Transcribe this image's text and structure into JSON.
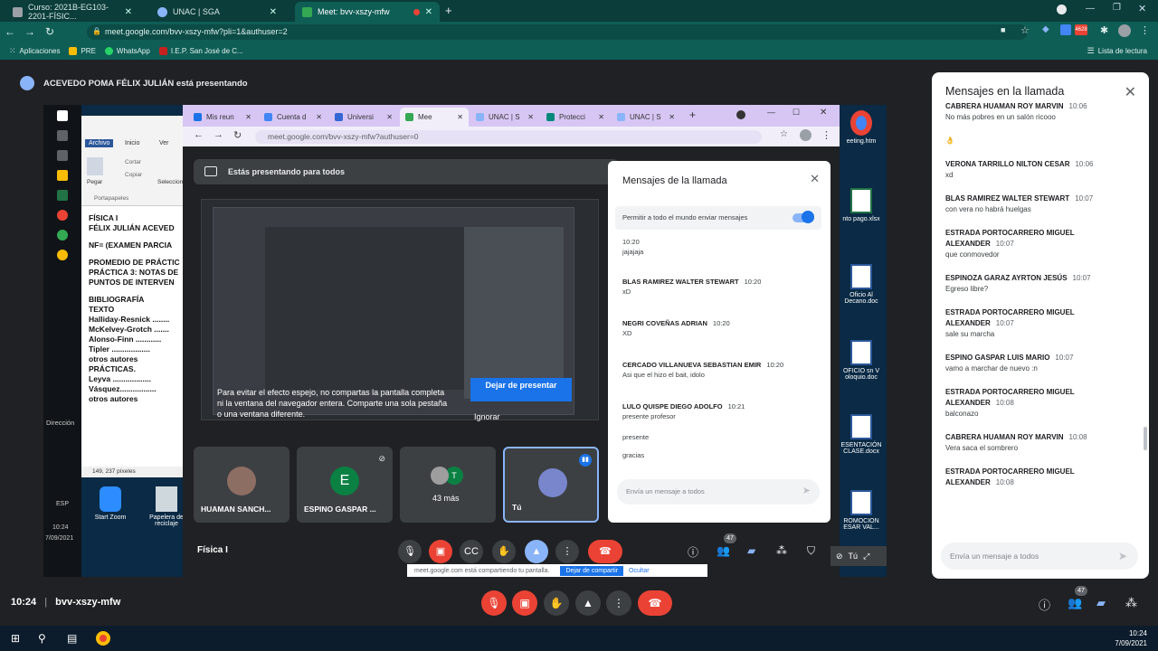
{
  "browser": {
    "tabs": [
      {
        "label": "Curso: 2021B-EG103-2201-FÍSIC...",
        "color": "#9aa0a6"
      },
      {
        "label": "UNAC | SGA",
        "color": "#8ab4f8"
      },
      {
        "label": "Meet: bvv-xszy-mfw",
        "color": "#34a853",
        "active": true
      }
    ],
    "new_tab": "+",
    "url": "meet.google.com/bvv-xszy-mfw?pli=1&authuser=2",
    "bookmarks": [
      "Aplicaciones",
      "PRE",
      "WhatsApp",
      "I.E.P. San José de C..."
    ],
    "reading_list": "Lista de lectura",
    "badge": "4628"
  },
  "presenting": {
    "banner": "ACEVEDO POMA FÉLIX JULIÁN está presentando"
  },
  "shared_screen": {
    "word_doc_lines": [
      "FÍSICA I",
      "FÉLIX JULIÁN ACEVED",
      "",
      "NF= (EXAMEN PARCIA",
      "",
      "PROMEDIO DE PRÁCTIC",
      "PRÁCTICA 3: NOTAS DE",
      "PUNTOS DE INTERVEN",
      "",
      "BIBLIOGRAFÍA",
      "TEXTO",
      "Halliday-Resnick ........",
      "McKelvey-Grotch .......",
      "Alonso-Finn ............",
      "Tipler ..................",
      "otros autores",
      "PRÁCTICAS.",
      "Leyva ..................",
      "Vásquez.................",
      "otros autores"
    ],
    "word_ribbon": [
      "Archivo",
      "Inicio",
      "Ver",
      "Pegar",
      "Cortar",
      "Copiar",
      "Portapapeles",
      "Seleccion"
    ],
    "word_status": "149, 237 píxeles",
    "left_labels": [
      "Dirección",
      "ESP",
      "10:24",
      "7/09/2021"
    ],
    "desktop_icons": [
      "Start Zoom",
      "Papelera de reciclaje",
      "eeting.htm",
      "nto pago.xlsx",
      "Oficio Al Decano.doc",
      "OFICIO sn V oloquio.doc",
      "ESENTACIÓN CLASE.docx",
      "ROMOCION ESAR VAL..."
    ],
    "inner_tabs": [
      "Mis reun",
      "Cuenta d",
      "Universi",
      "Mee",
      "UNAC | S",
      "Protecci",
      "UNAC | S"
    ],
    "inner_url": "meet.google.com/bvv-xszy-mfw?authuser=0",
    "present_banner": "Estás presentando para todos",
    "mirror_warning": "Para evitar el efecto espejo, no compartas la pantalla completa ni la ventana del navegador entera. Comparte una sola pestaña o una ventana diferente.",
    "stop_presenting": "Dejar de presentar",
    "ignore": "Ignorar",
    "tiles": [
      {
        "name": "HUAMAN SANCH...",
        "initial": ""
      },
      {
        "name": "ESPINO GASPAR ...",
        "initial": "E"
      },
      {
        "name": "43 más",
        "initial": "T"
      },
      {
        "name": "Tú",
        "initial": ""
      }
    ],
    "meeting_name": "Física I",
    "share_notice": "meet.google.com está compartiendo tu pantalla.",
    "share_stop": "Dejar de compartir",
    "share_hide": "Ocultar",
    "inner_chat": {
      "title": "Mensajes de la llamada",
      "toggle_label": "Permitir a todo el mundo enviar mensajes",
      "messages": [
        {
          "author": "",
          "time": "10:20",
          "text": "jajajaja"
        },
        {
          "author": "BLAS RAMIREZ WALTER STEWART",
          "time": "10:20",
          "text": "xD"
        },
        {
          "author": "NEGRI COVEÑAS ADRIAN",
          "time": "10:20",
          "text": "XD"
        },
        {
          "author": "CERCADO VILLANUEVA SEBASTIAN EMIR",
          "time": "10:20",
          "text": "Asi que el hizo el bait, idolo"
        },
        {
          "author": "LULO QUISPE DIEGO ADOLFO",
          "time": "10:21",
          "text": "presente profesor"
        },
        {
          "author": "",
          "time": "",
          "text": "presente"
        },
        {
          "author": "",
          "time": "",
          "text": "gracias"
        }
      ],
      "input_placeholder": "Envía un mensaje a todos"
    },
    "self_controls": [
      "Tú"
    ],
    "participants_count": "47"
  },
  "chat": {
    "title": "Mensajes en la llamada",
    "messages": [
      {
        "author": "CABRERA HUAMAN ROY MARVIN",
        "time": "10:06",
        "text": "No más pobres en un salón ricooo"
      },
      {
        "author": "",
        "time": "",
        "text": "👌"
      },
      {
        "author": "VERONA TARRILLO NILTON CESAR",
        "time": "10:06",
        "text": "xd"
      },
      {
        "author": "BLAS RAMIREZ WALTER STEWART",
        "time": "10:07",
        "text": "con vera no habrá huelgas"
      },
      {
        "author": "ESTRADA PORTOCARRERO MIGUEL ALEXANDER",
        "time": "10:07",
        "text": "que conmovedor"
      },
      {
        "author": "ESPINOZA GARAZ AYRTON JESÚS",
        "time": "10:07",
        "text": "Egreso libre?"
      },
      {
        "author": "ESTRADA PORTOCARRERO MIGUEL ALEXANDER",
        "time": "10:07",
        "text": "sale su marcha"
      },
      {
        "author": "ESPINO GASPAR LUIS MARIO",
        "time": "10:07",
        "text": "vamo a marchar de nuevo :n"
      },
      {
        "author": "ESTRADA PORTOCARRERO MIGUEL ALEXANDER",
        "time": "10:08",
        "text": "balconazo"
      },
      {
        "author": "CABRERA HUAMAN ROY MARVIN",
        "time": "10:08",
        "text": "Vera saca el sombrero"
      },
      {
        "author": "ESTRADA PORTOCARRERO MIGUEL ALEXANDER",
        "time": "10:08",
        "text": ""
      }
    ],
    "input_placeholder": "Envía un mensaje a todos"
  },
  "meetbar": {
    "time_code": "10:24",
    "separator": "|",
    "code": "bvv-xszy-mfw",
    "participants": "47"
  },
  "taskbar": {
    "time": "10:24",
    "date": "7/09/2021"
  },
  "colors": {
    "chrome_frame": "#0f5e56",
    "end_call": "#ea4335",
    "accent": "#1a73e8"
  }
}
